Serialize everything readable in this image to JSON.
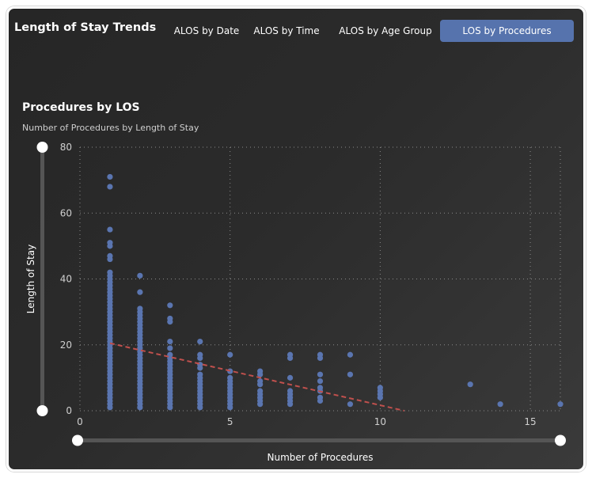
{
  "header": {
    "title": "Length of Stay Trends",
    "tabs": [
      {
        "label": "ALOS by Date",
        "active": false
      },
      {
        "label": "ALOS by Time",
        "active": false
      },
      {
        "label": "ALOS by Age Group",
        "active": false
      },
      {
        "label": "LOS by Procedures",
        "active": true
      }
    ]
  },
  "colors": {
    "accent": "#5673ad",
    "point": "#5a75b0",
    "trend": "#c0504d",
    "background": "#2a2a2a"
  },
  "chart_data": {
    "type": "scatter",
    "title": "Procedures by LOS",
    "subtitle": "Number of Procedures by Length of Stay",
    "xlabel": "Number of Procedures",
    "ylabel": "Length of Stay",
    "xlim": [
      0,
      16
    ],
    "ylim": [
      0,
      80
    ],
    "x_ticks": [
      0,
      5,
      10,
      15
    ],
    "y_ticks": [
      0,
      20,
      40,
      60,
      80
    ],
    "grid": true,
    "range_sliders": {
      "x": true,
      "y": true
    },
    "points": [
      {
        "x": 1,
        "y": 71
      },
      {
        "x": 1,
        "y": 68
      },
      {
        "x": 1,
        "y": 55
      },
      {
        "x": 1,
        "y": 51
      },
      {
        "x": 1,
        "y": 50
      },
      {
        "x": 1,
        "y": 47
      },
      {
        "x": 1,
        "y": 46
      },
      {
        "x": 1,
        "y": 42
      },
      {
        "x": 1,
        "y": 41
      },
      {
        "x": 1,
        "y": 40
      },
      {
        "x": 1,
        "y": 39
      },
      {
        "x": 1,
        "y": 38
      },
      {
        "x": 1,
        "y": 37
      },
      {
        "x": 1,
        "y": 36
      },
      {
        "x": 1,
        "y": 35
      },
      {
        "x": 1,
        "y": 34
      },
      {
        "x": 1,
        "y": 33
      },
      {
        "x": 1,
        "y": 32
      },
      {
        "x": 1,
        "y": 31
      },
      {
        "x": 1,
        "y": 30
      },
      {
        "x": 1,
        "y": 29
      },
      {
        "x": 1,
        "y": 28
      },
      {
        "x": 1,
        "y": 27
      },
      {
        "x": 1,
        "y": 26
      },
      {
        "x": 1,
        "y": 25
      },
      {
        "x": 1,
        "y": 24
      },
      {
        "x": 1,
        "y": 23
      },
      {
        "x": 1,
        "y": 22
      },
      {
        "x": 1,
        "y": 21
      },
      {
        "x": 1,
        "y": 20
      },
      {
        "x": 1,
        "y": 19
      },
      {
        "x": 1,
        "y": 18
      },
      {
        "x": 1,
        "y": 17
      },
      {
        "x": 1,
        "y": 16
      },
      {
        "x": 1,
        "y": 15
      },
      {
        "x": 1,
        "y": 14
      },
      {
        "x": 1,
        "y": 13
      },
      {
        "x": 1,
        "y": 12
      },
      {
        "x": 1,
        "y": 11
      },
      {
        "x": 1,
        "y": 10
      },
      {
        "x": 1,
        "y": 9
      },
      {
        "x": 1,
        "y": 8
      },
      {
        "x": 1,
        "y": 7
      },
      {
        "x": 1,
        "y": 6
      },
      {
        "x": 1,
        "y": 5
      },
      {
        "x": 1,
        "y": 4
      },
      {
        "x": 1,
        "y": 3
      },
      {
        "x": 1,
        "y": 2
      },
      {
        "x": 1,
        "y": 1
      },
      {
        "x": 2,
        "y": 41
      },
      {
        "x": 2,
        "y": 36
      },
      {
        "x": 2,
        "y": 31
      },
      {
        "x": 2,
        "y": 30
      },
      {
        "x": 2,
        "y": 29
      },
      {
        "x": 2,
        "y": 28
      },
      {
        "x": 2,
        "y": 27
      },
      {
        "x": 2,
        "y": 26
      },
      {
        "x": 2,
        "y": 25
      },
      {
        "x": 2,
        "y": 24
      },
      {
        "x": 2,
        "y": 23
      },
      {
        "x": 2,
        "y": 22
      },
      {
        "x": 2,
        "y": 21
      },
      {
        "x": 2,
        "y": 20
      },
      {
        "x": 2,
        "y": 19
      },
      {
        "x": 2,
        "y": 18
      },
      {
        "x": 2,
        "y": 17
      },
      {
        "x": 2,
        "y": 16
      },
      {
        "x": 2,
        "y": 15
      },
      {
        "x": 2,
        "y": 14
      },
      {
        "x": 2,
        "y": 13
      },
      {
        "x": 2,
        "y": 12
      },
      {
        "x": 2,
        "y": 11
      },
      {
        "x": 2,
        "y": 10
      },
      {
        "x": 2,
        "y": 9
      },
      {
        "x": 2,
        "y": 8
      },
      {
        "x": 2,
        "y": 7
      },
      {
        "x": 2,
        "y": 6
      },
      {
        "x": 2,
        "y": 5
      },
      {
        "x": 2,
        "y": 4
      },
      {
        "x": 2,
        "y": 3
      },
      {
        "x": 2,
        "y": 2
      },
      {
        "x": 2,
        "y": 1
      },
      {
        "x": 3,
        "y": 32
      },
      {
        "x": 3,
        "y": 28
      },
      {
        "x": 3,
        "y": 27
      },
      {
        "x": 3,
        "y": 21
      },
      {
        "x": 3,
        "y": 19
      },
      {
        "x": 3,
        "y": 17
      },
      {
        "x": 3,
        "y": 16
      },
      {
        "x": 3,
        "y": 15
      },
      {
        "x": 3,
        "y": 14
      },
      {
        "x": 3,
        "y": 13
      },
      {
        "x": 3,
        "y": 12
      },
      {
        "x": 3,
        "y": 11
      },
      {
        "x": 3,
        "y": 10
      },
      {
        "x": 3,
        "y": 9
      },
      {
        "x": 3,
        "y": 8
      },
      {
        "x": 3,
        "y": 7
      },
      {
        "x": 3,
        "y": 6
      },
      {
        "x": 3,
        "y": 5
      },
      {
        "x": 3,
        "y": 4
      },
      {
        "x": 3,
        "y": 3
      },
      {
        "x": 3,
        "y": 2
      },
      {
        "x": 3,
        "y": 1
      },
      {
        "x": 4,
        "y": 21
      },
      {
        "x": 4,
        "y": 17
      },
      {
        "x": 4,
        "y": 16
      },
      {
        "x": 4,
        "y": 14
      },
      {
        "x": 4,
        "y": 13
      },
      {
        "x": 4,
        "y": 11
      },
      {
        "x": 4,
        "y": 10
      },
      {
        "x": 4,
        "y": 9
      },
      {
        "x": 4,
        "y": 8
      },
      {
        "x": 4,
        "y": 7
      },
      {
        "x": 4,
        "y": 6
      },
      {
        "x": 4,
        "y": 5
      },
      {
        "x": 4,
        "y": 4
      },
      {
        "x": 4,
        "y": 3
      },
      {
        "x": 4,
        "y": 2
      },
      {
        "x": 4,
        "y": 1
      },
      {
        "x": 5,
        "y": 17
      },
      {
        "x": 5,
        "y": 12
      },
      {
        "x": 5,
        "y": 10
      },
      {
        "x": 5,
        "y": 9
      },
      {
        "x": 5,
        "y": 8
      },
      {
        "x": 5,
        "y": 7
      },
      {
        "x": 5,
        "y": 6
      },
      {
        "x": 5,
        "y": 5
      },
      {
        "x": 5,
        "y": 4
      },
      {
        "x": 5,
        "y": 3
      },
      {
        "x": 5,
        "y": 2
      },
      {
        "x": 5,
        "y": 1
      },
      {
        "x": 6,
        "y": 12
      },
      {
        "x": 6,
        "y": 11
      },
      {
        "x": 6,
        "y": 9
      },
      {
        "x": 6,
        "y": 8
      },
      {
        "x": 6,
        "y": 6
      },
      {
        "x": 6,
        "y": 5
      },
      {
        "x": 6,
        "y": 4
      },
      {
        "x": 6,
        "y": 3
      },
      {
        "x": 6,
        "y": 2
      },
      {
        "x": 7,
        "y": 17
      },
      {
        "x": 7,
        "y": 16
      },
      {
        "x": 7,
        "y": 10
      },
      {
        "x": 7,
        "y": 6
      },
      {
        "x": 7,
        "y": 5
      },
      {
        "x": 7,
        "y": 4
      },
      {
        "x": 7,
        "y": 3
      },
      {
        "x": 7,
        "y": 2
      },
      {
        "x": 8,
        "y": 17
      },
      {
        "x": 8,
        "y": 16
      },
      {
        "x": 8,
        "y": 11
      },
      {
        "x": 8,
        "y": 9
      },
      {
        "x": 8,
        "y": 7
      },
      {
        "x": 8,
        "y": 6
      },
      {
        "x": 8,
        "y": 4
      },
      {
        "x": 8,
        "y": 3
      },
      {
        "x": 9,
        "y": 17
      },
      {
        "x": 9,
        "y": 11
      },
      {
        "x": 9,
        "y": 2
      },
      {
        "x": 10,
        "y": 7
      },
      {
        "x": 10,
        "y": 6
      },
      {
        "x": 10,
        "y": 5
      },
      {
        "x": 10,
        "y": 4
      },
      {
        "x": 13,
        "y": 8
      },
      {
        "x": 14,
        "y": 2
      },
      {
        "x": 16,
        "y": 2
      }
    ],
    "trendline": {
      "style": "dashed",
      "from": {
        "x": 1,
        "y": 20.5
      },
      "to": {
        "x": 10.8,
        "y": 0
      }
    }
  }
}
